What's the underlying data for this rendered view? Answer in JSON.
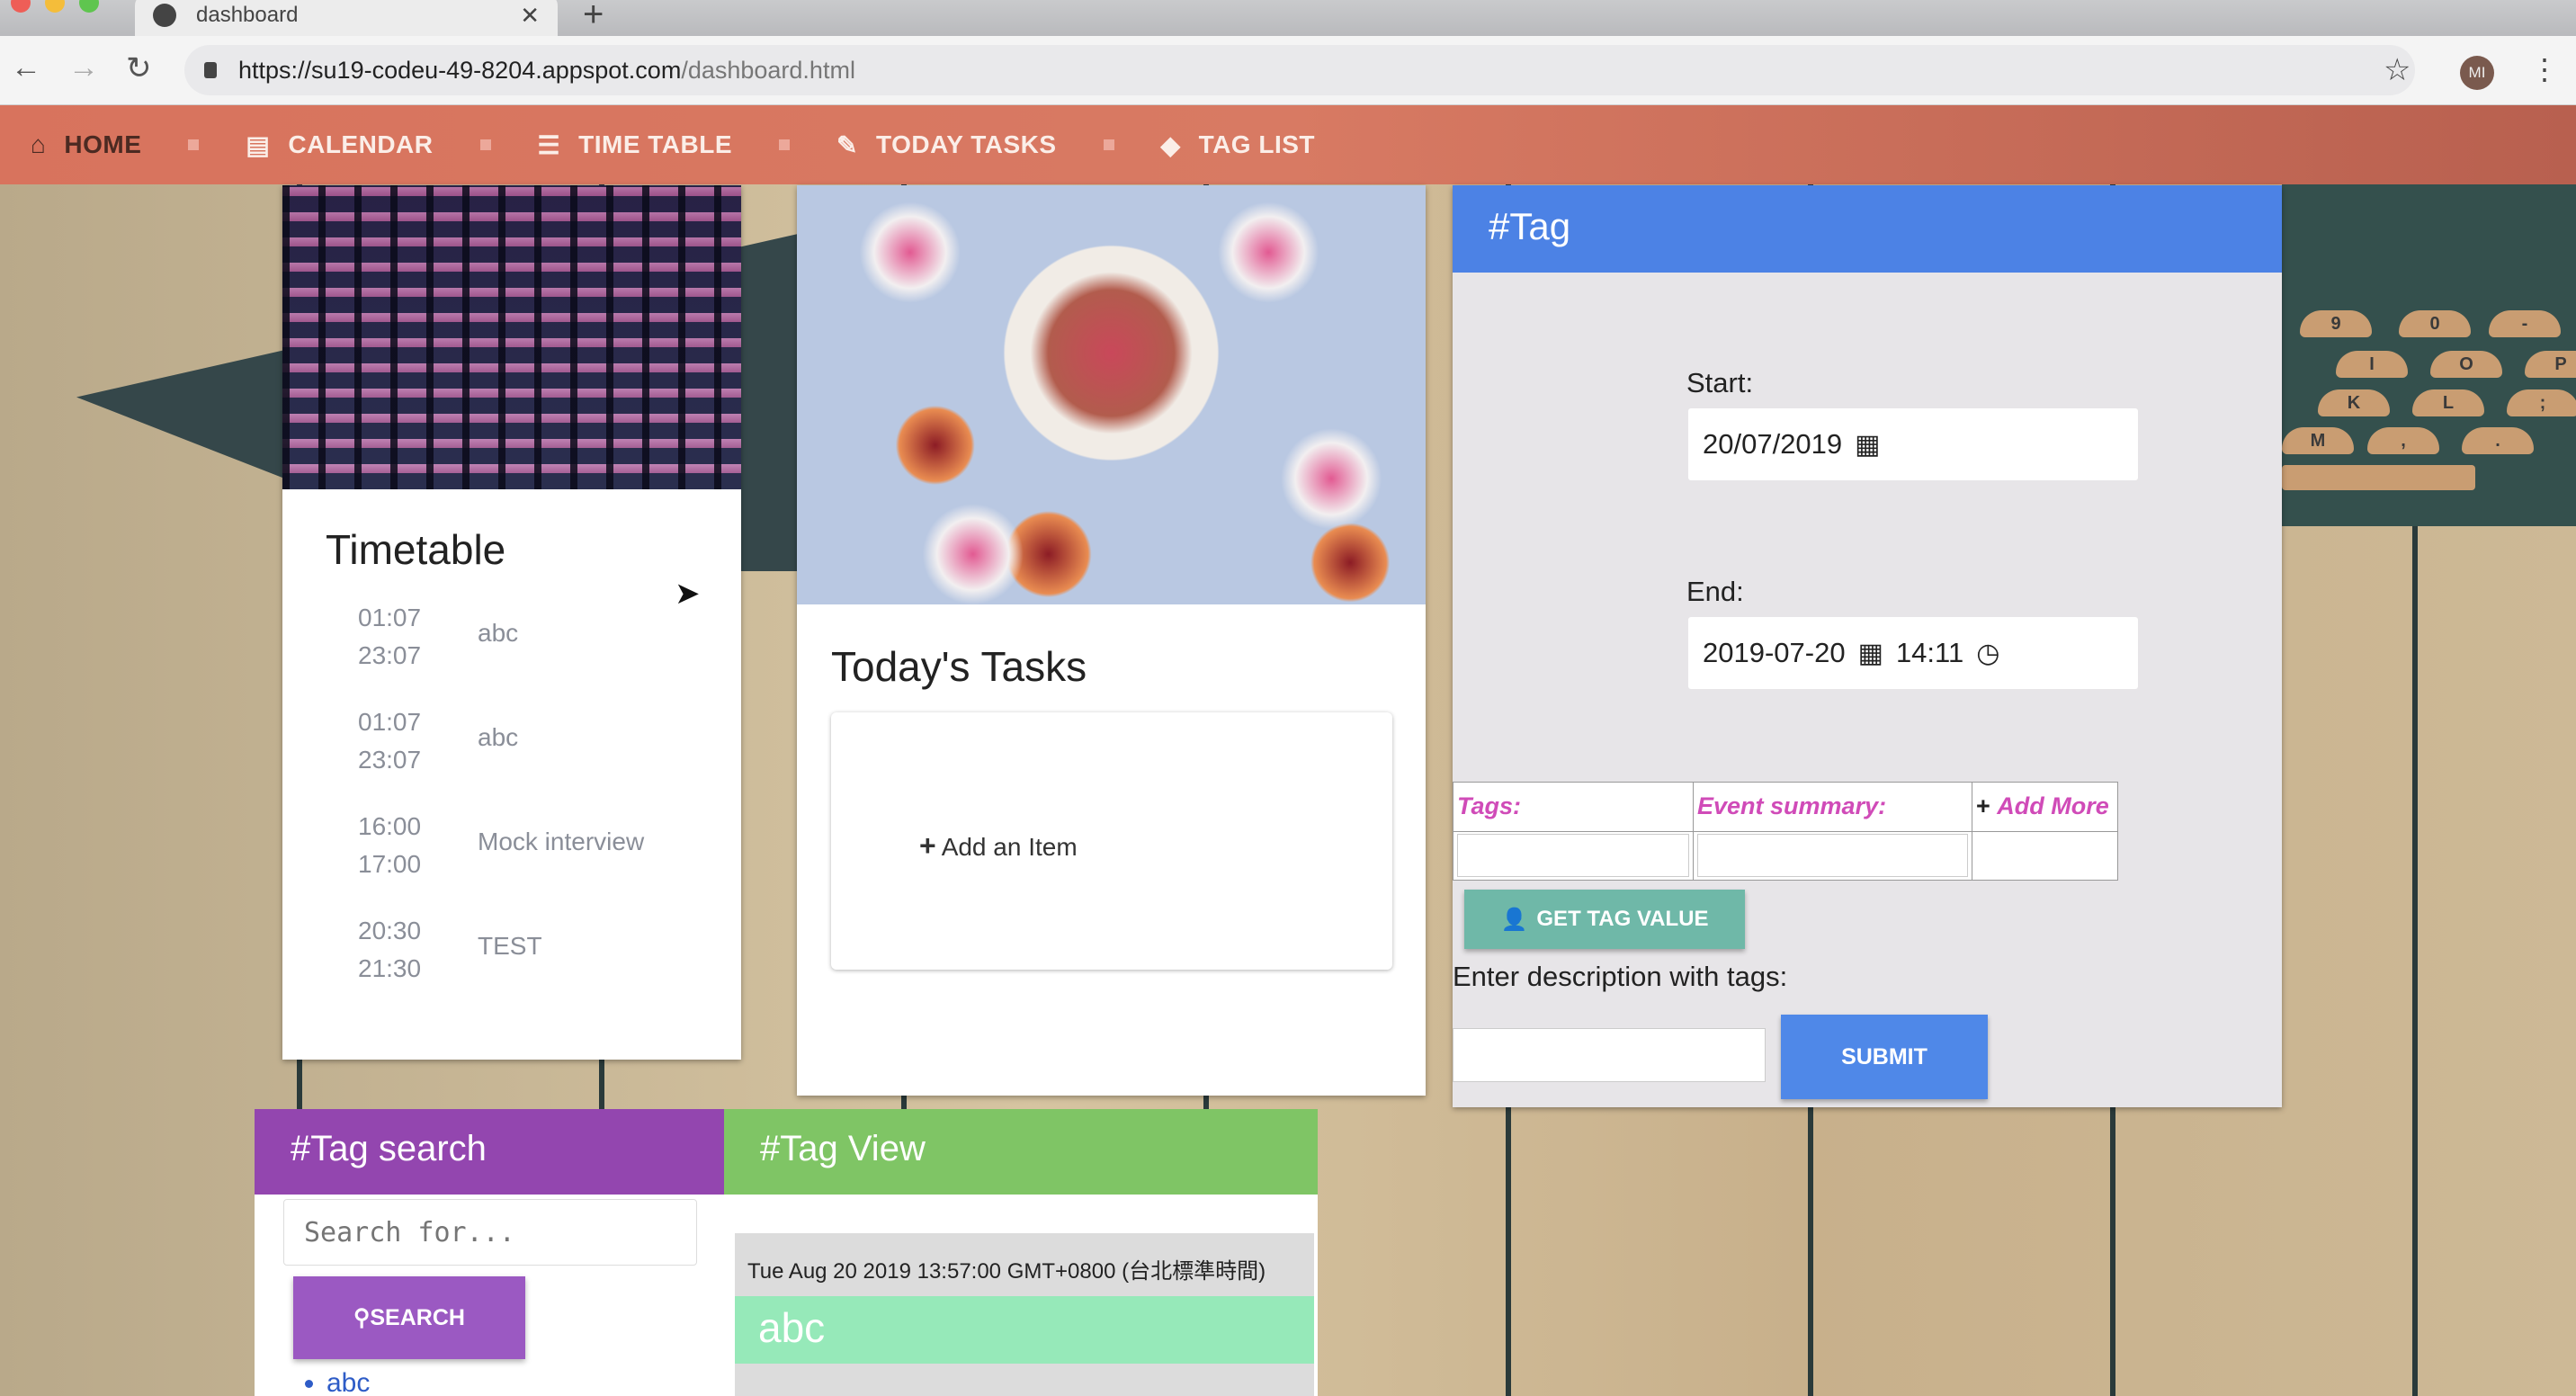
{
  "browser": {
    "tab_title": "dashboard",
    "new_tab_label": "+",
    "url_host": "https://su19-codeu-49-8204.appspot.com",
    "url_path": "/dashboard.html",
    "profile_initials": "MI"
  },
  "nav": {
    "items": [
      {
        "label": "HOME",
        "icon": "home-icon",
        "glyph": "⌂",
        "active": true
      },
      {
        "label": "CALENDAR",
        "icon": "book-icon",
        "glyph": "▤"
      },
      {
        "label": "TIME TABLE",
        "icon": "list-icon",
        "glyph": "☰"
      },
      {
        "label": "TODAY TASKS",
        "icon": "pencil-icon",
        "glyph": "✎"
      },
      {
        "label": "TAG LIST",
        "icon": "tag-icon",
        "glyph": "◆"
      }
    ]
  },
  "timetable": {
    "title": "Timetable",
    "rows": [
      {
        "start": "01:07",
        "end": "23:07",
        "name": "abc"
      },
      {
        "start": "01:07",
        "end": "23:07",
        "name": "abc"
      },
      {
        "start": "16:00",
        "end": "17:00",
        "name": "Mock interview"
      },
      {
        "start": "20:30",
        "end": "21:30",
        "name": "TEST"
      }
    ]
  },
  "tasks": {
    "title": "Today's Tasks",
    "add_item_label": "Add an Item"
  },
  "tag": {
    "header": "#Tag",
    "start_label": "Start:",
    "start_value": "20/07/2019",
    "end_label": "End:",
    "end_date": "2019-07-20",
    "end_time": "14:11",
    "col_tags": "Tags:",
    "col_summary": "Event summary:",
    "add_more": "Add More",
    "get_tag_value": "GET TAG VALUE",
    "desc_label": "Enter description with tags:",
    "submit": "SUBMIT",
    "accent": "#4c82e5"
  },
  "tag_search": {
    "header": "#Tag search",
    "placeholder": "Search for...",
    "button": "SEARCH",
    "results": [
      "abc"
    ],
    "accent": "#9346af"
  },
  "tag_view": {
    "header": "#Tag View",
    "entries": [
      {
        "date": "Tue Aug 20 2019 13:57:00 GMT+0800 (台北標準時間)",
        "tag": "abc"
      }
    ],
    "accent": "#7fc565"
  }
}
